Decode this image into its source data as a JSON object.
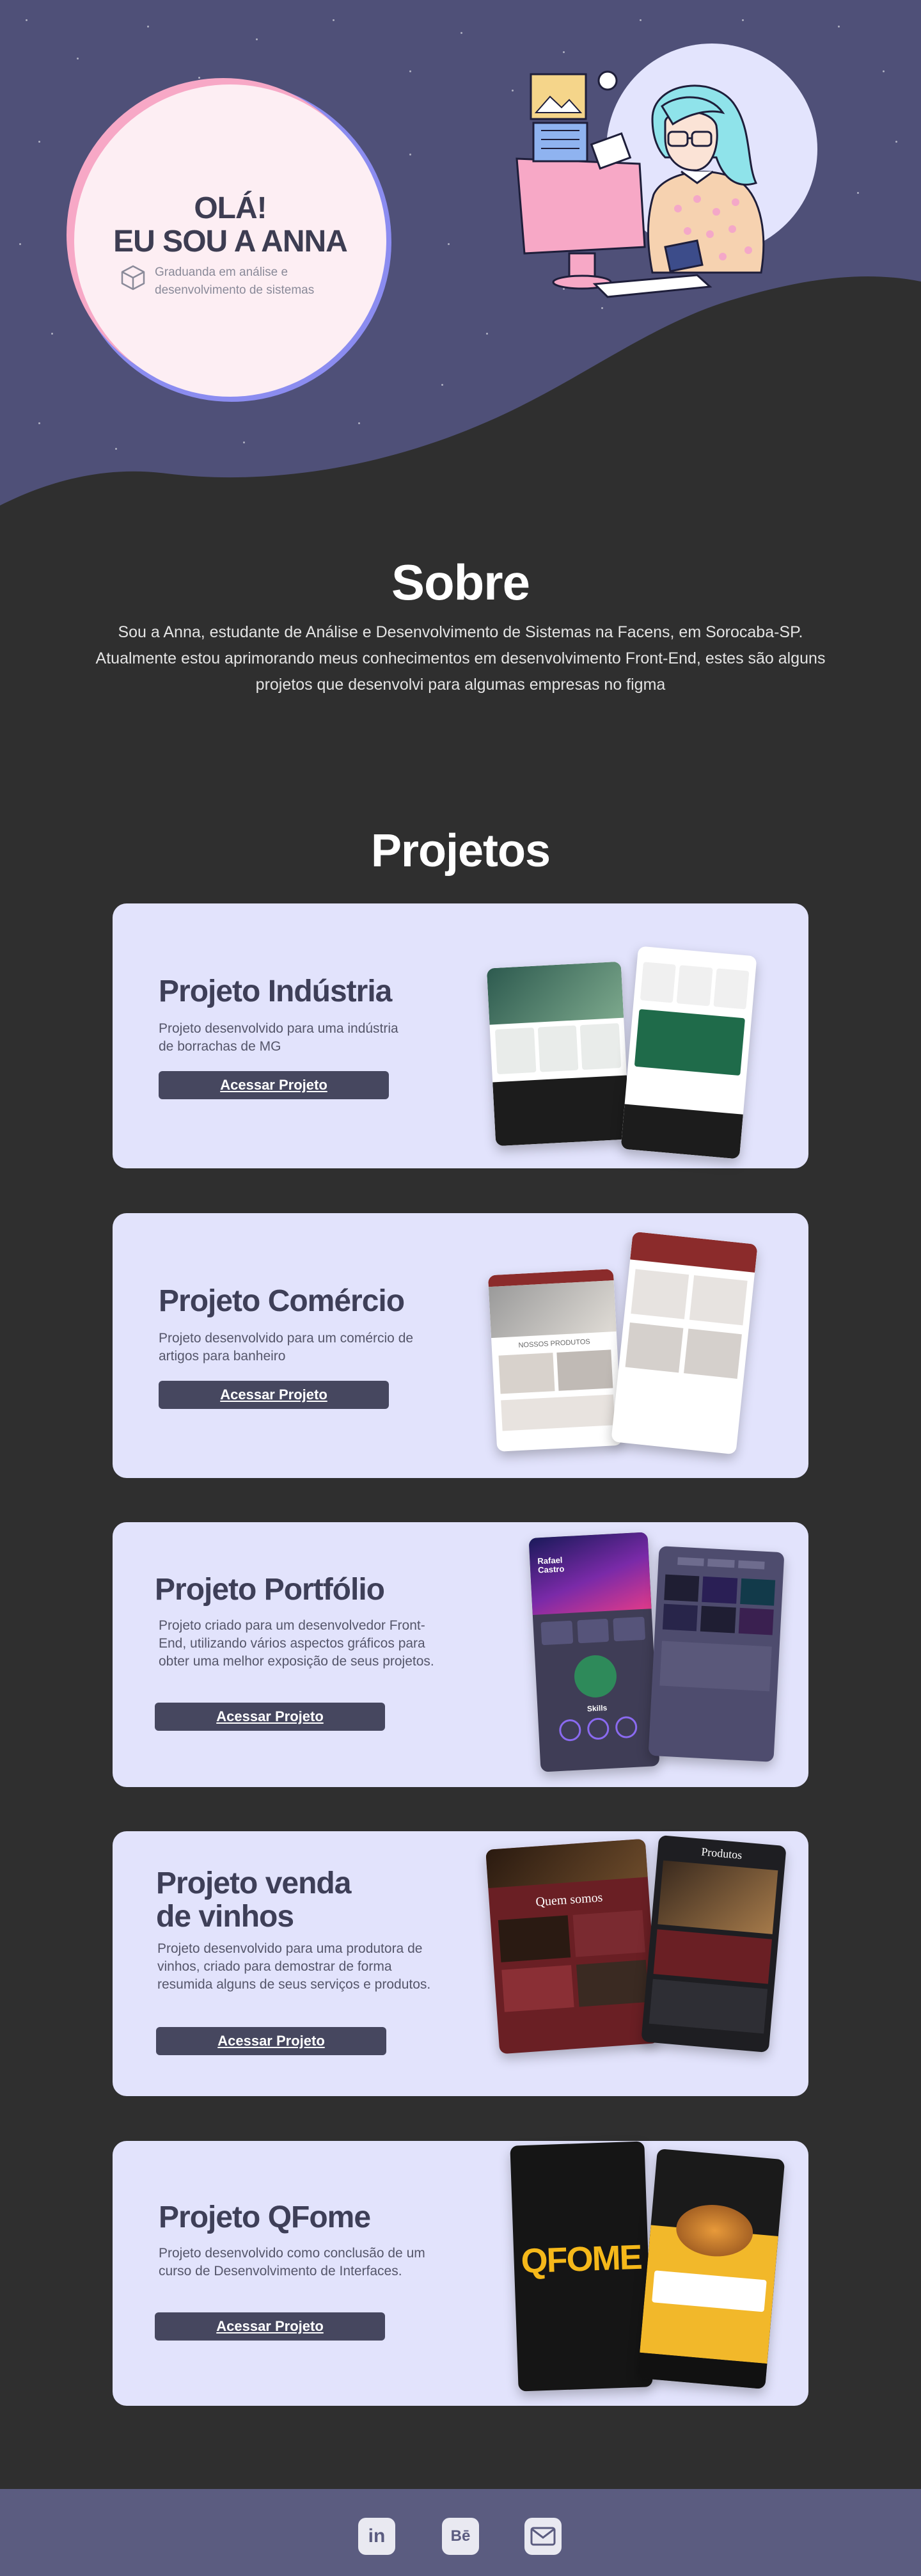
{
  "hero": {
    "greeting_line1": "OLÁ!",
    "greeting_line2": "EU SOU A ANNA",
    "subtitle": "Graduanda em análise e desenvolvimento de sistemas",
    "colors": {
      "sky": "#4f5078",
      "circle": "#fdeef3",
      "ring_pink": "#f7a8c6",
      "ring_purple": "#8b8cf0"
    }
  },
  "about": {
    "title": "Sobre",
    "text": "Sou a Anna, estudante de Análise e Desenvolvimento de Sistemas na Facens, em Sorocaba-SP. Atualmente estou aprimorando meus conhecimentos em desenvolvimento Front-End, estes são alguns projetos que desenvolvi para algumas empresas no figma"
  },
  "projects": {
    "title": "Projetos",
    "items": [
      {
        "title": "Projeto Indústria",
        "description": "Projeto desenvolvido para uma indústria de borrachas de MG",
        "button": "Acessar Projeto"
      },
      {
        "title": "Projeto Comércio",
        "description": "Projeto desenvolvido para um comércio de artigos para banheiro",
        "button": "Acessar Projeto"
      },
      {
        "title": "Projeto Portfólio",
        "description": "Projeto criado para um desenvolvedor Front-End, utilizando vários aspectos gráficos para obter uma melhor exposição de seus projetos.",
        "button": "Acessar Projeto"
      },
      {
        "title_line1": "Projeto venda",
        "title_line2": "de vinhos",
        "description": "Projeto desenvolvido para uma produtora de vinhos, criado para demostrar de forma resumida alguns de seus serviços e produtos.",
        "button": "Acessar Projeto"
      },
      {
        "title": "Projeto QFome",
        "description": "Projeto desenvolvido como conclusão de um curso de Desenvolvimento de Interfaces.",
        "button": "Acessar Projeto"
      }
    ]
  },
  "mockups": {
    "portfolio_name": "Rafael Castro",
    "portfolio_skills": "Skills",
    "wine_about": "Quem somos",
    "wine_products": "Produtos",
    "comercio_products": "NOSSOS PRODUTOS",
    "qfome_logo": "QFOME"
  },
  "footer": {
    "linkedin": "in",
    "behance": "Bē",
    "icons": [
      "linkedin-icon",
      "behance-icon",
      "mail-icon"
    ]
  }
}
